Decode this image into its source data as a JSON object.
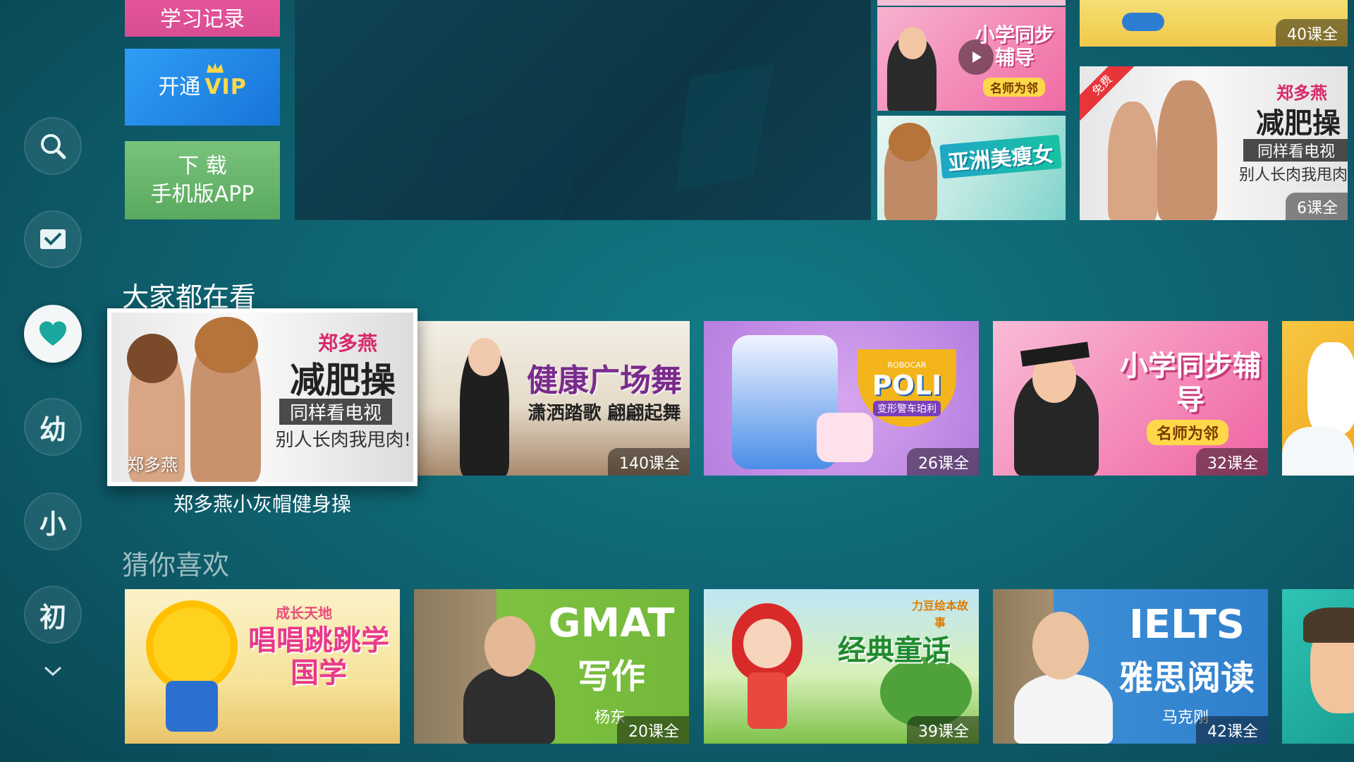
{
  "quick_actions": {
    "record_label": "学习记录",
    "vip_prefix": "开通",
    "vip_brand": "VIP",
    "app_line1": "下 载",
    "app_line2": "手机版APP"
  },
  "rail": {
    "items": [
      {
        "name": "search"
      },
      {
        "name": "inbox"
      },
      {
        "name": "favorite"
      },
      {
        "label": "幼"
      },
      {
        "label": "小"
      },
      {
        "label": "初"
      }
    ]
  },
  "top_tiles": {
    "t1_badge": "40课全",
    "t2_title": "小学同步辅导",
    "t2_sub": "名师为邻",
    "t3_title": "亚洲美瘦女",
    "t4_tag": "免费",
    "t4_title": "郑多燕",
    "t4_main": "减肥操",
    "t4_line1": "同样看电视",
    "t4_line2": "别人长肉我甩肉",
    "t4_badge": "6课全"
  },
  "section1": {
    "title": "大家都在看",
    "focused": {
      "brand": "郑多燕",
      "main": "减肥操",
      "line1": "同样看电视",
      "line2": "别人长肉我甩肉!",
      "corner": "郑多燕",
      "label": "郑多燕小灰帽健身操"
    },
    "cards": [
      {
        "title": "健康广场舞",
        "sub": "潇洒踏歌 翩翩起舞",
        "badge": "140课全"
      },
      {
        "title": "POLI",
        "brand": "ROBOCAR",
        "sub": "变形警车珀利",
        "badge": "26课全"
      },
      {
        "title": "小学同步辅导",
        "sub": "名师为邻",
        "badge": "32课全"
      }
    ]
  },
  "section2": {
    "title": "猜你喜欢",
    "cards": [
      {
        "brand": "成长天地",
        "title": "唱唱跳跳学国学"
      },
      {
        "title": "GMAT",
        "sub": "写作",
        "teacher": "杨东",
        "badge": "20课全"
      },
      {
        "brand": "力豆绘本故事",
        "title": "经典童话",
        "badge": "39课全"
      },
      {
        "title": "IELTS",
        "sub": "雅思阅读",
        "teacher": "马克刚",
        "badge": "42课全"
      }
    ]
  },
  "colors": {
    "accent_teal": "#1aa79e",
    "vip_gold": "#ffd84a",
    "record_pink": "#e95aa0",
    "vip_blue": "#1f86e6",
    "app_green": "#6bb76e"
  }
}
